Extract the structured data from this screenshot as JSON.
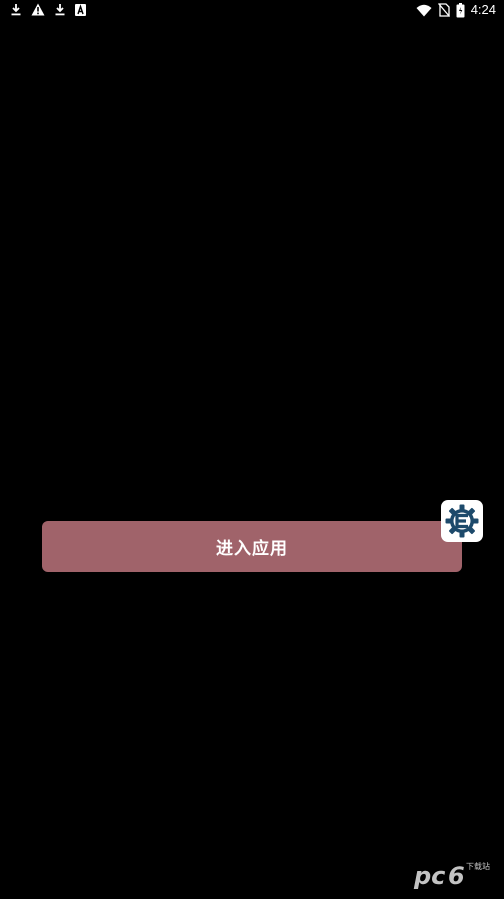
{
  "status_bar": {
    "time": "4:24",
    "left_icons": [
      "download-icon",
      "warning-icon",
      "download-icon",
      "font-a-icon"
    ],
    "right_icons": [
      "wifi-icon",
      "no-sim-icon",
      "battery-icon"
    ]
  },
  "main": {
    "enter_button_label": "进入应用",
    "enter_button_color": "#a0636a",
    "floating_icon": "cheat-engine-gear-icon",
    "floating_icon_color": "#1d4a6b"
  },
  "watermark": {
    "logo_text": "pc6",
    "sub_text": "下载站"
  }
}
